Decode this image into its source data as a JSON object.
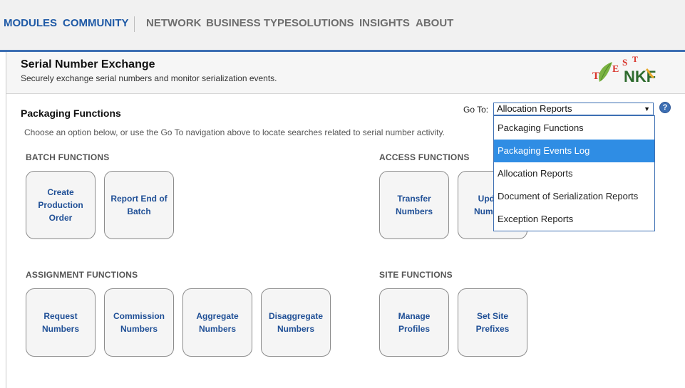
{
  "nav": {
    "modules": "MODULES",
    "community": "COMMUNITY",
    "network": "NETWORK",
    "business_type": "BUSINESS TYPE",
    "solutions": "SOLUTIONS",
    "insights": "INSIGHTS",
    "about": "ABOUT"
  },
  "header": {
    "title": "Serial Number Exchange",
    "subtitle": "Securely exchange serial numbers and monitor serialization events.",
    "logo_text": "TESTNKF"
  },
  "main": {
    "section_title": "Packaging Functions",
    "help_text": "Choose an option below, or use the Go To navigation above to locate searches related to serial number activity.",
    "goto_label": "Go To:",
    "goto_selected": "Allocation Reports",
    "help_icon": "?",
    "dropdown_options": [
      "Packaging Functions",
      "Packaging Events Log",
      "Allocation Reports",
      "Document of Serialization Reports",
      "Exception Reports"
    ],
    "highlighted_option": "Packaging Events Log"
  },
  "groups": {
    "batch": {
      "label": "BATCH FUNCTIONS",
      "buttons": [
        "Create Production Order",
        "Report End of Batch"
      ]
    },
    "access": {
      "label": "ACCESS FUNCTIONS",
      "buttons": [
        "Transfer Numbers",
        "Update Numbers"
      ]
    },
    "assignment": {
      "label": "ASSIGNMENT FUNCTIONS",
      "buttons": [
        "Request Numbers",
        "Commission Numbers",
        "Aggregate Numbers",
        "Disaggregate Numbers"
      ]
    },
    "site": {
      "label": "SITE FUNCTIONS",
      "buttons": [
        "Manage Profiles",
        "Set Site Prefixes"
      ]
    }
  },
  "colors": {
    "accent": "#3d6fb3",
    "link_blue": "#1f5aa6",
    "selected_option": "#2f8de4"
  }
}
